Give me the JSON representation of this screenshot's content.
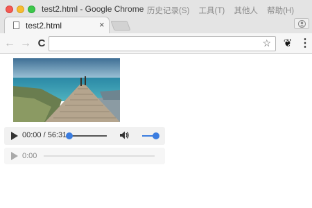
{
  "window": {
    "title": "test2.html - Google Chrome",
    "menu": [
      "历史记录(S)",
      "工具(T)",
      "其他人",
      "帮助(H)"
    ]
  },
  "tab": {
    "label": "test2.html",
    "close_glyph": "×"
  },
  "toolbar": {
    "back_glyph": "←",
    "forward_glyph": "→",
    "reload_glyph": "C",
    "url": "",
    "star_glyph": "☆",
    "extension_glyph": "❦",
    "menu_glyph": "⋮"
  },
  "video_player": {
    "time": "00:00 / 56:31",
    "progress": 0,
    "volume": 1.0
  },
  "audio_player": {
    "time": "0:00",
    "progress": 0
  },
  "icons": {
    "video": "video-thumbnail-pier",
    "play": "play-icon",
    "volume": "volume-icon"
  }
}
